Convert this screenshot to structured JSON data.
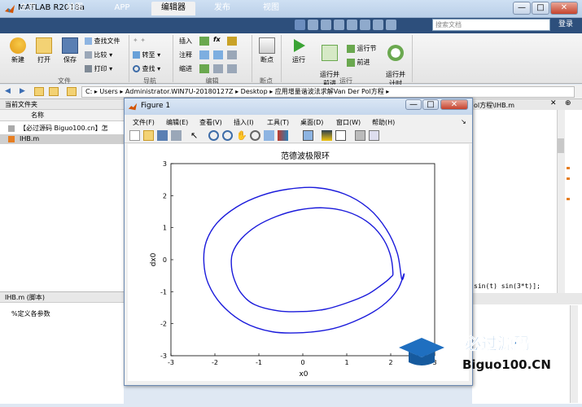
{
  "window": {
    "title": "MATLAB R2018a",
    "minimize": "—",
    "maximize": "□",
    "close": "✕"
  },
  "tabs": [
    "主页",
    "绘图",
    "APP",
    "编辑器",
    "发布",
    "视图"
  ],
  "active_tab": "编辑器",
  "search": {
    "placeholder": "搜索文档"
  },
  "login": "登录",
  "ribbon": {
    "file": {
      "new": "新建",
      "open": "打开",
      "save": "保存",
      "find_files": "查找文件",
      "compare": "比较",
      "print": "打印",
      "section": "文件"
    },
    "nav": {
      "goto": "转至",
      "find": "查找",
      "section": "导航"
    },
    "edit": {
      "insert": "插入",
      "comment": "注释",
      "indent": "缩进",
      "fx": "fx",
      "section": "编辑"
    },
    "breakpoints": {
      "label": "断点",
      "section": "断点"
    },
    "run": {
      "run": "运行",
      "run_advance": "运行并\n前进",
      "run_section": "运行节",
      "advance": "前进",
      "run_time": "运行并\n计时",
      "section": "运行"
    }
  },
  "address": {
    "segments": [
      "C:",
      "Users",
      "Administrator.WIN7U-20180127Z",
      "Desktop",
      "应用增量谐波法求解Van Der Pol方程"
    ]
  },
  "left_panel": {
    "title": "当前文件夹",
    "column": "名称",
    "files": [
      "【必过源码 Biguo100.cn】怎",
      "IHB.m"
    ],
    "detail_title": "IHB.m (脚本)",
    "detail_text": "%定义各参数"
  },
  "editor": {
    "tab_text": "ol方程\\IHB.m",
    "code_line": "sin(t) sin(3*t)];"
  },
  "figure": {
    "title": "Figure 1",
    "menus": [
      "文件(F)",
      "编辑(E)",
      "查看(V)",
      "插入(I)",
      "工具(T)",
      "桌面(D)",
      "窗口(W)",
      "帮助(H)"
    ]
  },
  "chart_data": {
    "type": "line",
    "title": "范德波极限环",
    "xlabel": "x0",
    "ylabel": "dx0",
    "xlim": [
      -3,
      3
    ],
    "ylim": [
      -3,
      3
    ],
    "xticks": [
      -3,
      -2,
      -1,
      0,
      1,
      2,
      3
    ],
    "yticks": [
      -3,
      -2,
      -1,
      0,
      1,
      2,
      3
    ],
    "color": "#1a1adb",
    "series": [
      {
        "x": [
          2.05,
          1.98,
          1.78,
          1.45,
          1.0,
          0.45,
          -0.1,
          -0.6,
          -1.05,
          -1.4,
          -1.6,
          -1.62,
          -1.55,
          -1.4,
          -1.1,
          -0.55,
          0.0,
          0.5,
          1.0,
          1.45,
          1.78,
          2.0,
          2.05
        ],
        "y": [
          -0.4,
          0.2,
          0.75,
          1.2,
          1.5,
          1.62,
          1.55,
          1.35,
          1.05,
          0.65,
          0.2,
          -0.25,
          -0.65,
          -1.05,
          -1.4,
          -1.6,
          -1.62,
          -1.55,
          -1.35,
          -1.1,
          -0.8,
          -0.55,
          -0.4
        ]
      },
      {
        "x": [
          2.25,
          2.15,
          1.9,
          1.5,
          0.95,
          0.3,
          -0.35,
          -0.95,
          -1.5,
          -1.95,
          -2.2,
          -2.25,
          -2.15,
          -1.85,
          -1.35,
          -0.7,
          0.0,
          0.7,
          1.3,
          1.8,
          2.15,
          2.3,
          2.25
        ],
        "y": [
          -0.6,
          0.2,
          0.95,
          1.6,
          2.05,
          2.25,
          2.2,
          2.0,
          1.65,
          1.15,
          0.55,
          -0.1,
          -0.75,
          -1.4,
          -1.95,
          -2.25,
          -2.28,
          -2.15,
          -1.85,
          -1.45,
          -0.95,
          -0.45,
          -0.6
        ]
      }
    ]
  },
  "watermark": {
    "title": "必过源码",
    "url": "Biguo100.CN"
  }
}
